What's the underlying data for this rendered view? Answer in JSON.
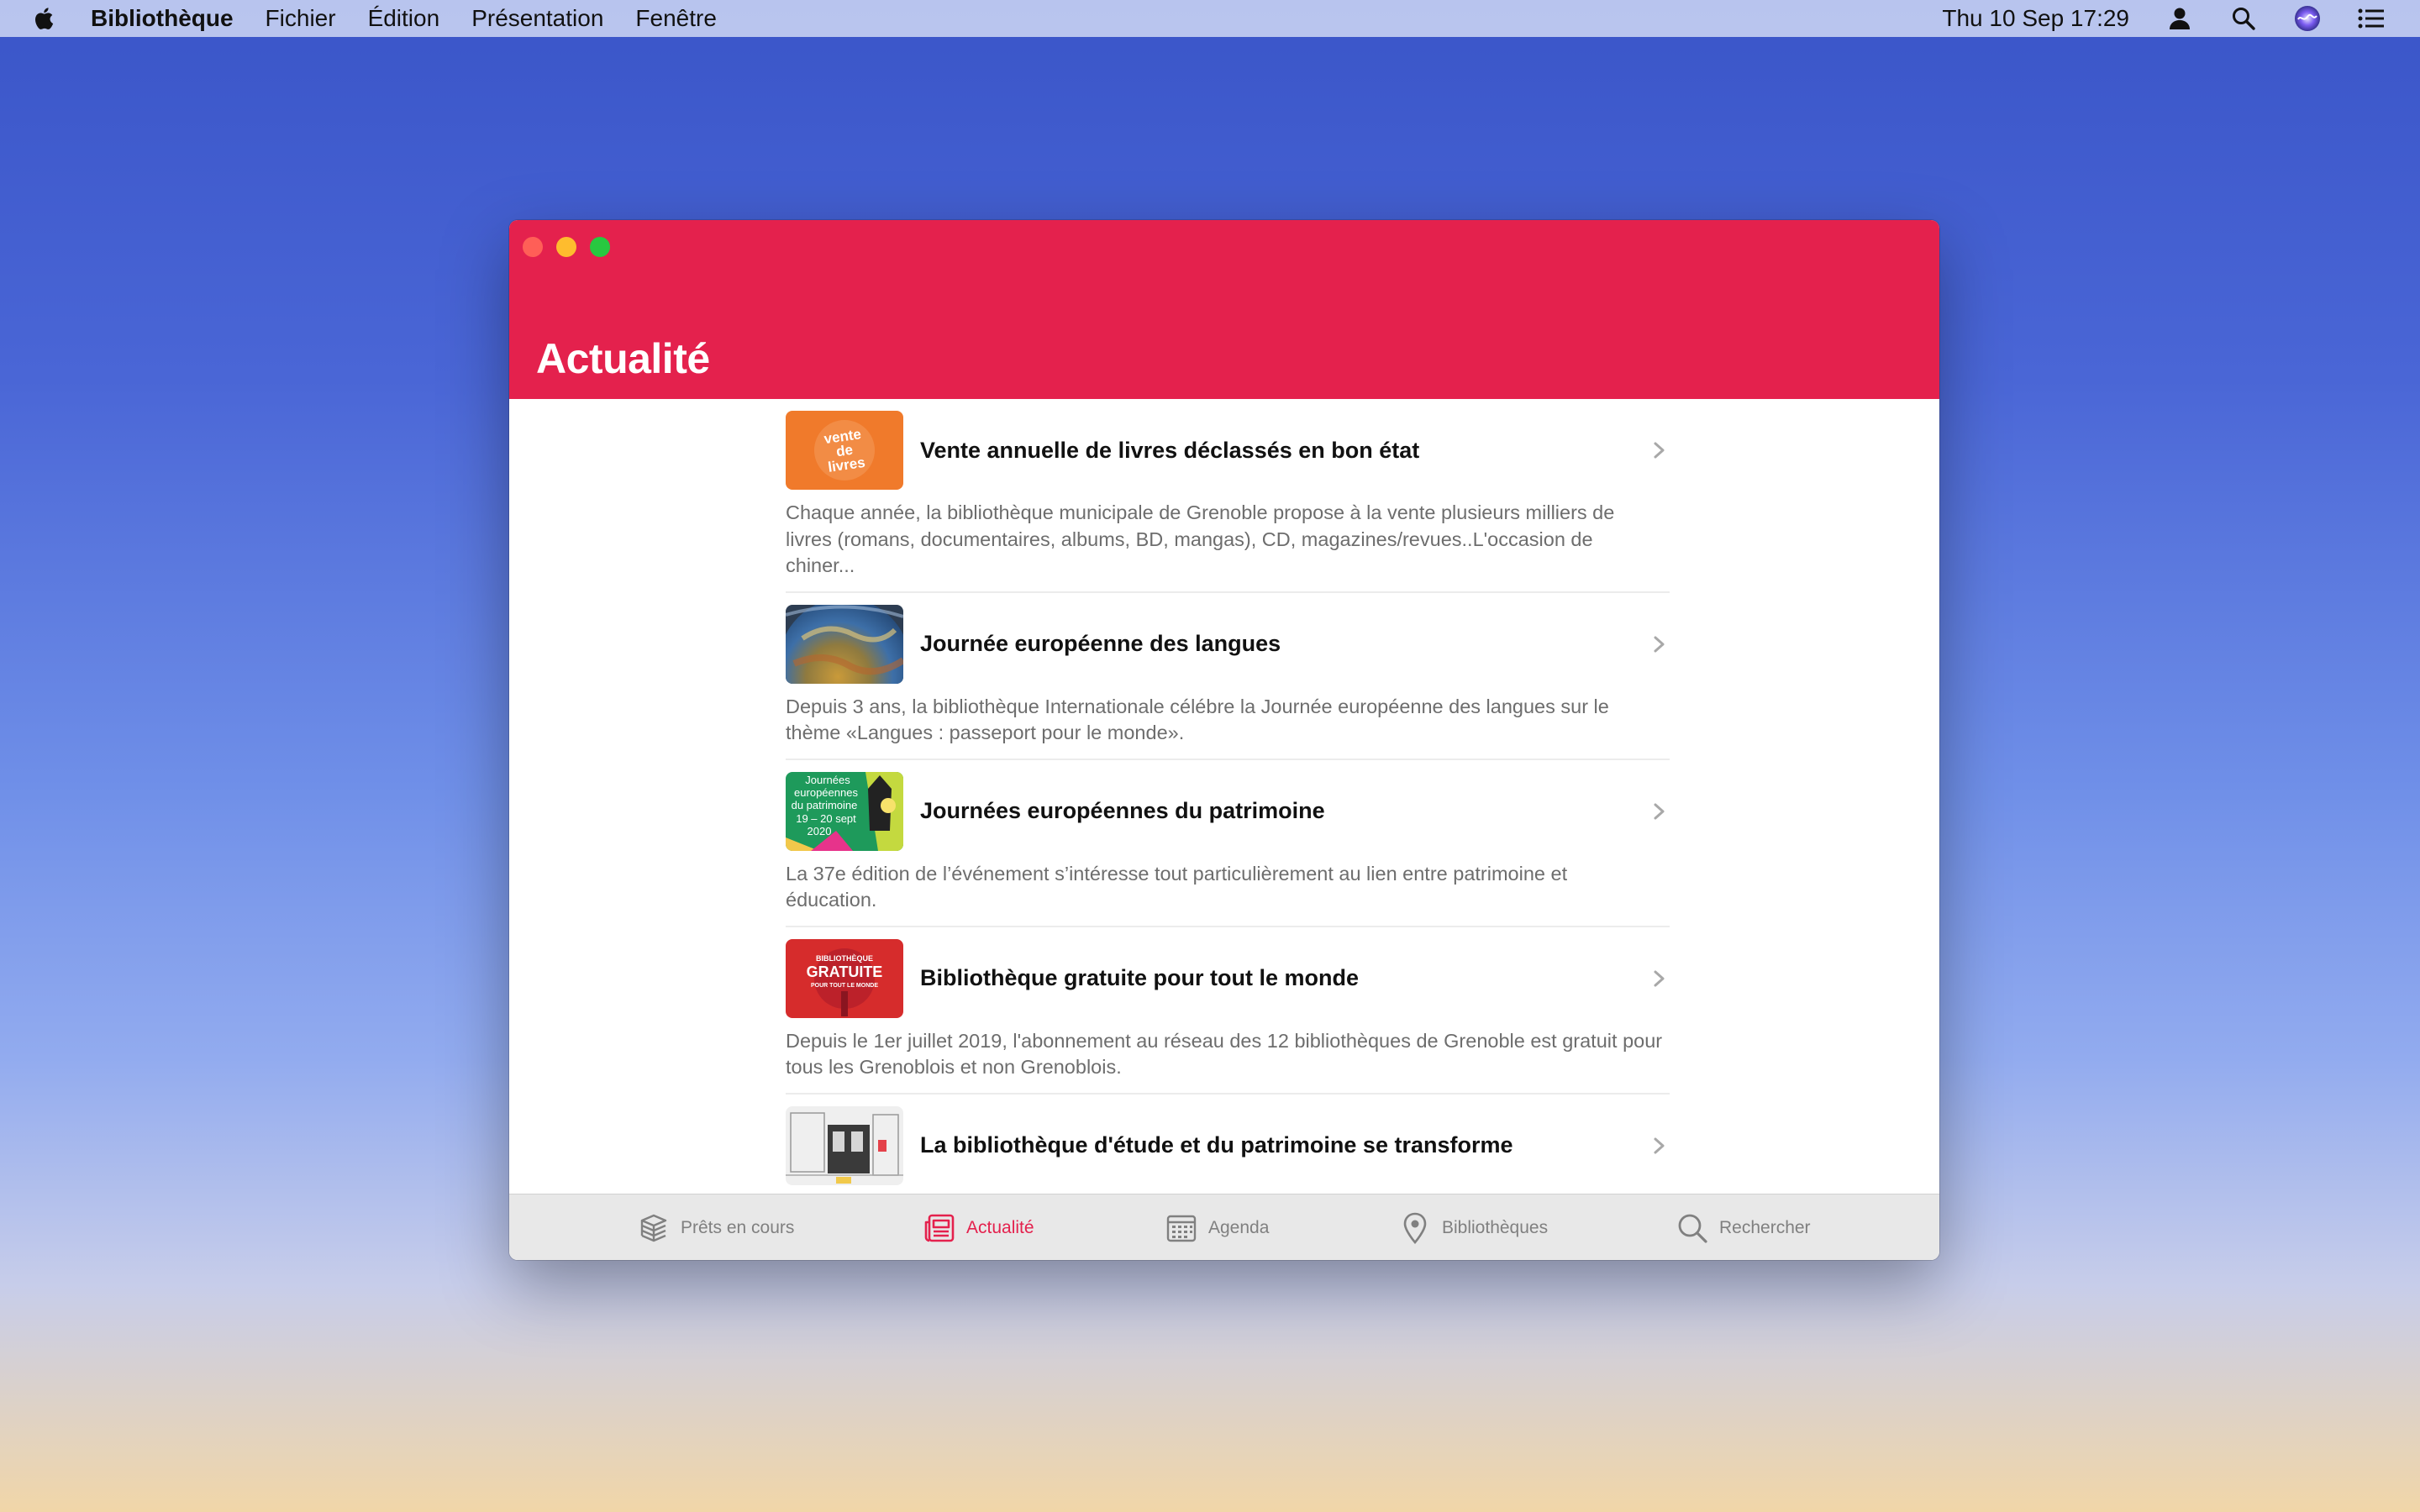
{
  "menubar": {
    "app_name": "Bibliothèque",
    "items": [
      "Fichier",
      "Édition",
      "Présentation",
      "Fenêtre"
    ],
    "datetime": "Thu 10 Sep  17:29",
    "status_icons": [
      "user-icon",
      "spotlight-search-icon",
      "siri-icon",
      "control-center-icon"
    ]
  },
  "window": {
    "title": "Actualité",
    "accent_color": "#e4214d"
  },
  "news": [
    {
      "title": "Vente annuelle de livres déclassés en bon état",
      "description": "Chaque année, la bibliothèque municipale de Grenoble propose à la vente plusieurs milliers de livres (romans, documentaires, albums, BD, mangas), CD, magazines/revues..L'occasion de chiner...",
      "thumb_text": [
        "vente",
        "de",
        "livres"
      ]
    },
    {
      "title": "Journée européenne des langues",
      "description": "Depuis 3 ans, la bibliothèque Internationale célébre la Journée européenne des langues sur le thème «Langues : passeport pour le monde»."
    },
    {
      "title": "Journées européennes du patrimoine",
      "description": "La 37e édition de l’événement s’intéresse tout particulièrement au lien entre patrimoine et éducation.",
      "thumb_text": [
        "Journées",
        "européennes",
        "du patrimoine",
        "19 – 20 sept",
        "2020"
      ]
    },
    {
      "title": "Bibliothèque gratuite pour tout le monde",
      "description": "Depuis le 1er juillet 2019, l'abonnement au réseau des 12 bibliothèques de Grenoble est gratuit pour tous les Grenoblois et non Grenoblois.",
      "thumb_text": [
        "BIBLIOTHÈQUE",
        "GRATUITE",
        "POUR TOUT LE MONDE"
      ]
    },
    {
      "title": "La bibliothèque d'étude et du patrimoine se transforme",
      "description": ""
    }
  ],
  "tabs": [
    {
      "label": "Prêts en cours",
      "icon": "books-stack-icon",
      "active": false
    },
    {
      "label": "Actualité",
      "icon": "newspaper-icon",
      "active": true
    },
    {
      "label": "Agenda",
      "icon": "calendar-icon",
      "active": false
    },
    {
      "label": "Bibliothèques",
      "icon": "location-pin-icon",
      "active": false
    },
    {
      "label": "Rechercher",
      "icon": "search-icon",
      "active": false
    }
  ]
}
